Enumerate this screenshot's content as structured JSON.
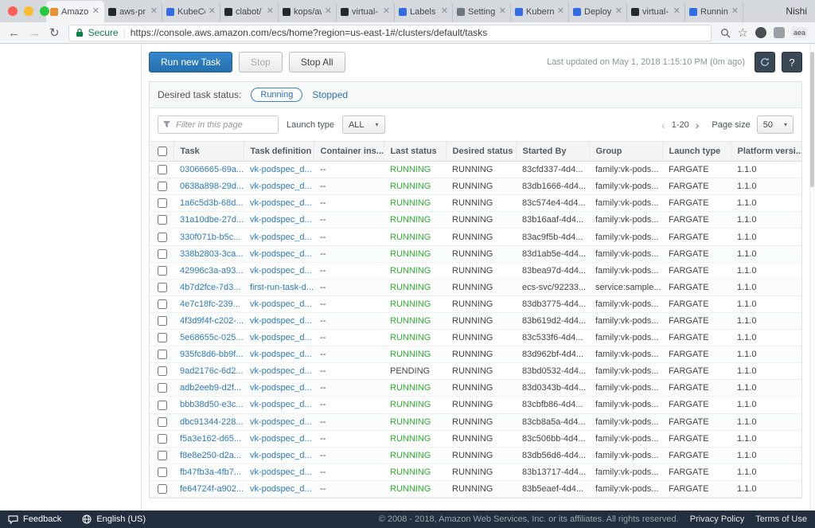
{
  "browser": {
    "profile_name": "Nishi",
    "tabs": [
      {
        "label": "Amazon",
        "icon_color": "#ec912d",
        "active": true
      },
      {
        "label": "aws-pr",
        "icon_color": "#24292e",
        "active": false
      },
      {
        "label": "KubeCo",
        "icon_color": "#326ce5",
        "active": false
      },
      {
        "label": "clabot/",
        "icon_color": "#24292e",
        "active": false
      },
      {
        "label": "kops/aw",
        "icon_color": "#24292e",
        "active": false
      },
      {
        "label": "virtual-",
        "icon_color": "#24292e",
        "active": false
      },
      {
        "label": "Labels",
        "icon_color": "#326ce5",
        "active": false
      },
      {
        "label": "Setting",
        "icon_color": "#6e7681",
        "active": false
      },
      {
        "label": "Kubern",
        "icon_color": "#326ce5",
        "active": false
      },
      {
        "label": "Deploy",
        "icon_color": "#326ce5",
        "active": false
      },
      {
        "label": "virtual-",
        "icon_color": "#24292e",
        "active": false
      },
      {
        "label": "Running",
        "icon_color": "#326ce5",
        "active": false
      }
    ],
    "address_bar": {
      "secure_label": "Secure",
      "url": "https://console.aws.amazon.com/ecs/home?region=us-east-1#/clusters/default/tasks",
      "extension_badge": "aea"
    }
  },
  "toolbar": {
    "run_new_task_label": "Run new Task",
    "stop_label": "Stop",
    "stop_all_label": "Stop All",
    "last_updated": "Last updated on May 1, 2018 1:15:10 PM (0m ago)"
  },
  "status_filter": {
    "label": "Desired task status:",
    "running_label": "Running",
    "stopped_label": "Stopped",
    "selected": "Running"
  },
  "filter_bar": {
    "filter_placeholder": "Filter in this page",
    "launch_type_label": "Launch type",
    "launch_type_value": "ALL",
    "page_range": "1-20",
    "page_size_label": "Page size",
    "page_size_value": "50"
  },
  "table": {
    "columns": [
      "Task",
      "Task definition",
      "Container ins...",
      "Last status",
      "Desired status",
      "Started By",
      "Group",
      "Launch type",
      "Platform versi..."
    ],
    "rows": [
      {
        "task": "03066665-69a...",
        "task_definition": "vk-podspec_d...",
        "container_instance": "--",
        "last_status": "RUNNING",
        "desired_status": "RUNNING",
        "started_by": "83cfd337-4d4...",
        "group": "family:vk-pods...",
        "launch_type": "FARGATE",
        "platform_version": "1.1.0"
      },
      {
        "task": "0638a898-29d...",
        "task_definition": "vk-podspec_d...",
        "container_instance": "--",
        "last_status": "RUNNING",
        "desired_status": "RUNNING",
        "started_by": "83db1666-4d4...",
        "group": "family:vk-pods...",
        "launch_type": "FARGATE",
        "platform_version": "1.1.0"
      },
      {
        "task": "1a6c5d3b-68d...",
        "task_definition": "vk-podspec_d...",
        "container_instance": "--",
        "last_status": "RUNNING",
        "desired_status": "RUNNING",
        "started_by": "83c574e4-4d4...",
        "group": "family:vk-pods...",
        "launch_type": "FARGATE",
        "platform_version": "1.1.0"
      },
      {
        "task": "31a10dbe-27d...",
        "task_definition": "vk-podspec_d...",
        "container_instance": "--",
        "last_status": "RUNNING",
        "desired_status": "RUNNING",
        "started_by": "83b16aaf-4d4...",
        "group": "family:vk-pods...",
        "launch_type": "FARGATE",
        "platform_version": "1.1.0"
      },
      {
        "task": "330f071b-b5c...",
        "task_definition": "vk-podspec_d...",
        "container_instance": "--",
        "last_status": "RUNNING",
        "desired_status": "RUNNING",
        "started_by": "83ac9f5b-4d4...",
        "group": "family:vk-pods...",
        "launch_type": "FARGATE",
        "platform_version": "1.1.0"
      },
      {
        "task": "338b2803-3ca...",
        "task_definition": "vk-podspec_d...",
        "container_instance": "--",
        "last_status": "RUNNING",
        "desired_status": "RUNNING",
        "started_by": "83d1ab5e-4d4...",
        "group": "family:vk-pods...",
        "launch_type": "FARGATE",
        "platform_version": "1.1.0"
      },
      {
        "task": "42996c3a-a93...",
        "task_definition": "vk-podspec_d...",
        "container_instance": "--",
        "last_status": "RUNNING",
        "desired_status": "RUNNING",
        "started_by": "83bea97d-4d4...",
        "group": "family:vk-pods...",
        "launch_type": "FARGATE",
        "platform_version": "1.1.0"
      },
      {
        "task": "4b7d2fce-7d3...",
        "task_definition": "first-run-task-d...",
        "container_instance": "--",
        "last_status": "RUNNING",
        "desired_status": "RUNNING",
        "started_by": "ecs-svc/92233...",
        "group": "service:sample...",
        "launch_type": "FARGATE",
        "platform_version": "1.1.0"
      },
      {
        "task": "4e7c18fc-239...",
        "task_definition": "vk-podspec_d...",
        "container_instance": "--",
        "last_status": "RUNNING",
        "desired_status": "RUNNING",
        "started_by": "83db3775-4d4...",
        "group": "family:vk-pods...",
        "launch_type": "FARGATE",
        "platform_version": "1.1.0"
      },
      {
        "task": "4f3d9f4f-c202-...",
        "task_definition": "vk-podspec_d...",
        "container_instance": "--",
        "last_status": "RUNNING",
        "desired_status": "RUNNING",
        "started_by": "83b619d2-4d4...",
        "group": "family:vk-pods...",
        "launch_type": "FARGATE",
        "platform_version": "1.1.0"
      },
      {
        "task": "5e68655c-025...",
        "task_definition": "vk-podspec_d...",
        "container_instance": "--",
        "last_status": "RUNNING",
        "desired_status": "RUNNING",
        "started_by": "83c533f6-4d4...",
        "group": "family:vk-pods...",
        "launch_type": "FARGATE",
        "platform_version": "1.1.0"
      },
      {
        "task": "935fc8d6-bb9f...",
        "task_definition": "vk-podspec_d...",
        "container_instance": "--",
        "last_status": "RUNNING",
        "desired_status": "RUNNING",
        "started_by": "83d962bf-4d4...",
        "group": "family:vk-pods...",
        "launch_type": "FARGATE",
        "platform_version": "1.1.0"
      },
      {
        "task": "9ad2176c-6d2...",
        "task_definition": "vk-podspec_d...",
        "container_instance": "--",
        "last_status": "PENDING",
        "desired_status": "RUNNING",
        "started_by": "83bd0532-4d4...",
        "group": "family:vk-pods...",
        "launch_type": "FARGATE",
        "platform_version": "1.1.0"
      },
      {
        "task": "adb2eeb9-d2f...",
        "task_definition": "vk-podspec_d...",
        "container_instance": "--",
        "last_status": "RUNNING",
        "desired_status": "RUNNING",
        "started_by": "83d0343b-4d4...",
        "group": "family:vk-pods...",
        "launch_type": "FARGATE",
        "platform_version": "1.1.0"
      },
      {
        "task": "bbb38d50-e3c...",
        "task_definition": "vk-podspec_d...",
        "container_instance": "--",
        "last_status": "RUNNING",
        "desired_status": "RUNNING",
        "started_by": "83cbfb86-4d4...",
        "group": "family:vk-pods...",
        "launch_type": "FARGATE",
        "platform_version": "1.1.0"
      },
      {
        "task": "dbc91344-228...",
        "task_definition": "vk-podspec_d...",
        "container_instance": "--",
        "last_status": "RUNNING",
        "desired_status": "RUNNING",
        "started_by": "83cb8a5a-4d4...",
        "group": "family:vk-pods...",
        "launch_type": "FARGATE",
        "platform_version": "1.1.0"
      },
      {
        "task": "f5a3e162-d65...",
        "task_definition": "vk-podspec_d...",
        "container_instance": "--",
        "last_status": "RUNNING",
        "desired_status": "RUNNING",
        "started_by": "83c506bb-4d4...",
        "group": "family:vk-pods...",
        "launch_type": "FARGATE",
        "platform_version": "1.1.0"
      },
      {
        "task": "f8e8e250-d2a...",
        "task_definition": "vk-podspec_d...",
        "container_instance": "--",
        "last_status": "RUNNING",
        "desired_status": "RUNNING",
        "started_by": "83db56d6-4d4...",
        "group": "family:vk-pods...",
        "launch_type": "FARGATE",
        "platform_version": "1.1.0"
      },
      {
        "task": "fb47fb3a-4fb7...",
        "task_definition": "vk-podspec_d...",
        "container_instance": "--",
        "last_status": "RUNNING",
        "desired_status": "RUNNING",
        "started_by": "83b13717-4d4...",
        "group": "family:vk-pods...",
        "launch_type": "FARGATE",
        "platform_version": "1.1.0"
      },
      {
        "task": "fe64724f-a902...",
        "task_definition": "vk-podspec_d...",
        "container_instance": "--",
        "last_status": "RUNNING",
        "desired_status": "RUNNING",
        "started_by": "83b5eaef-4d4...",
        "group": "family:vk-pods...",
        "launch_type": "FARGATE",
        "platform_version": "1.1.0"
      }
    ]
  },
  "footer": {
    "feedback_label": "Feedback",
    "language_label": "English (US)",
    "copyright": "© 2008 - 2018, Amazon Web Services, Inc. or its affiliates. All rights reserved.",
    "privacy_label": "Privacy Policy",
    "terms_label": "Terms of Use"
  }
}
